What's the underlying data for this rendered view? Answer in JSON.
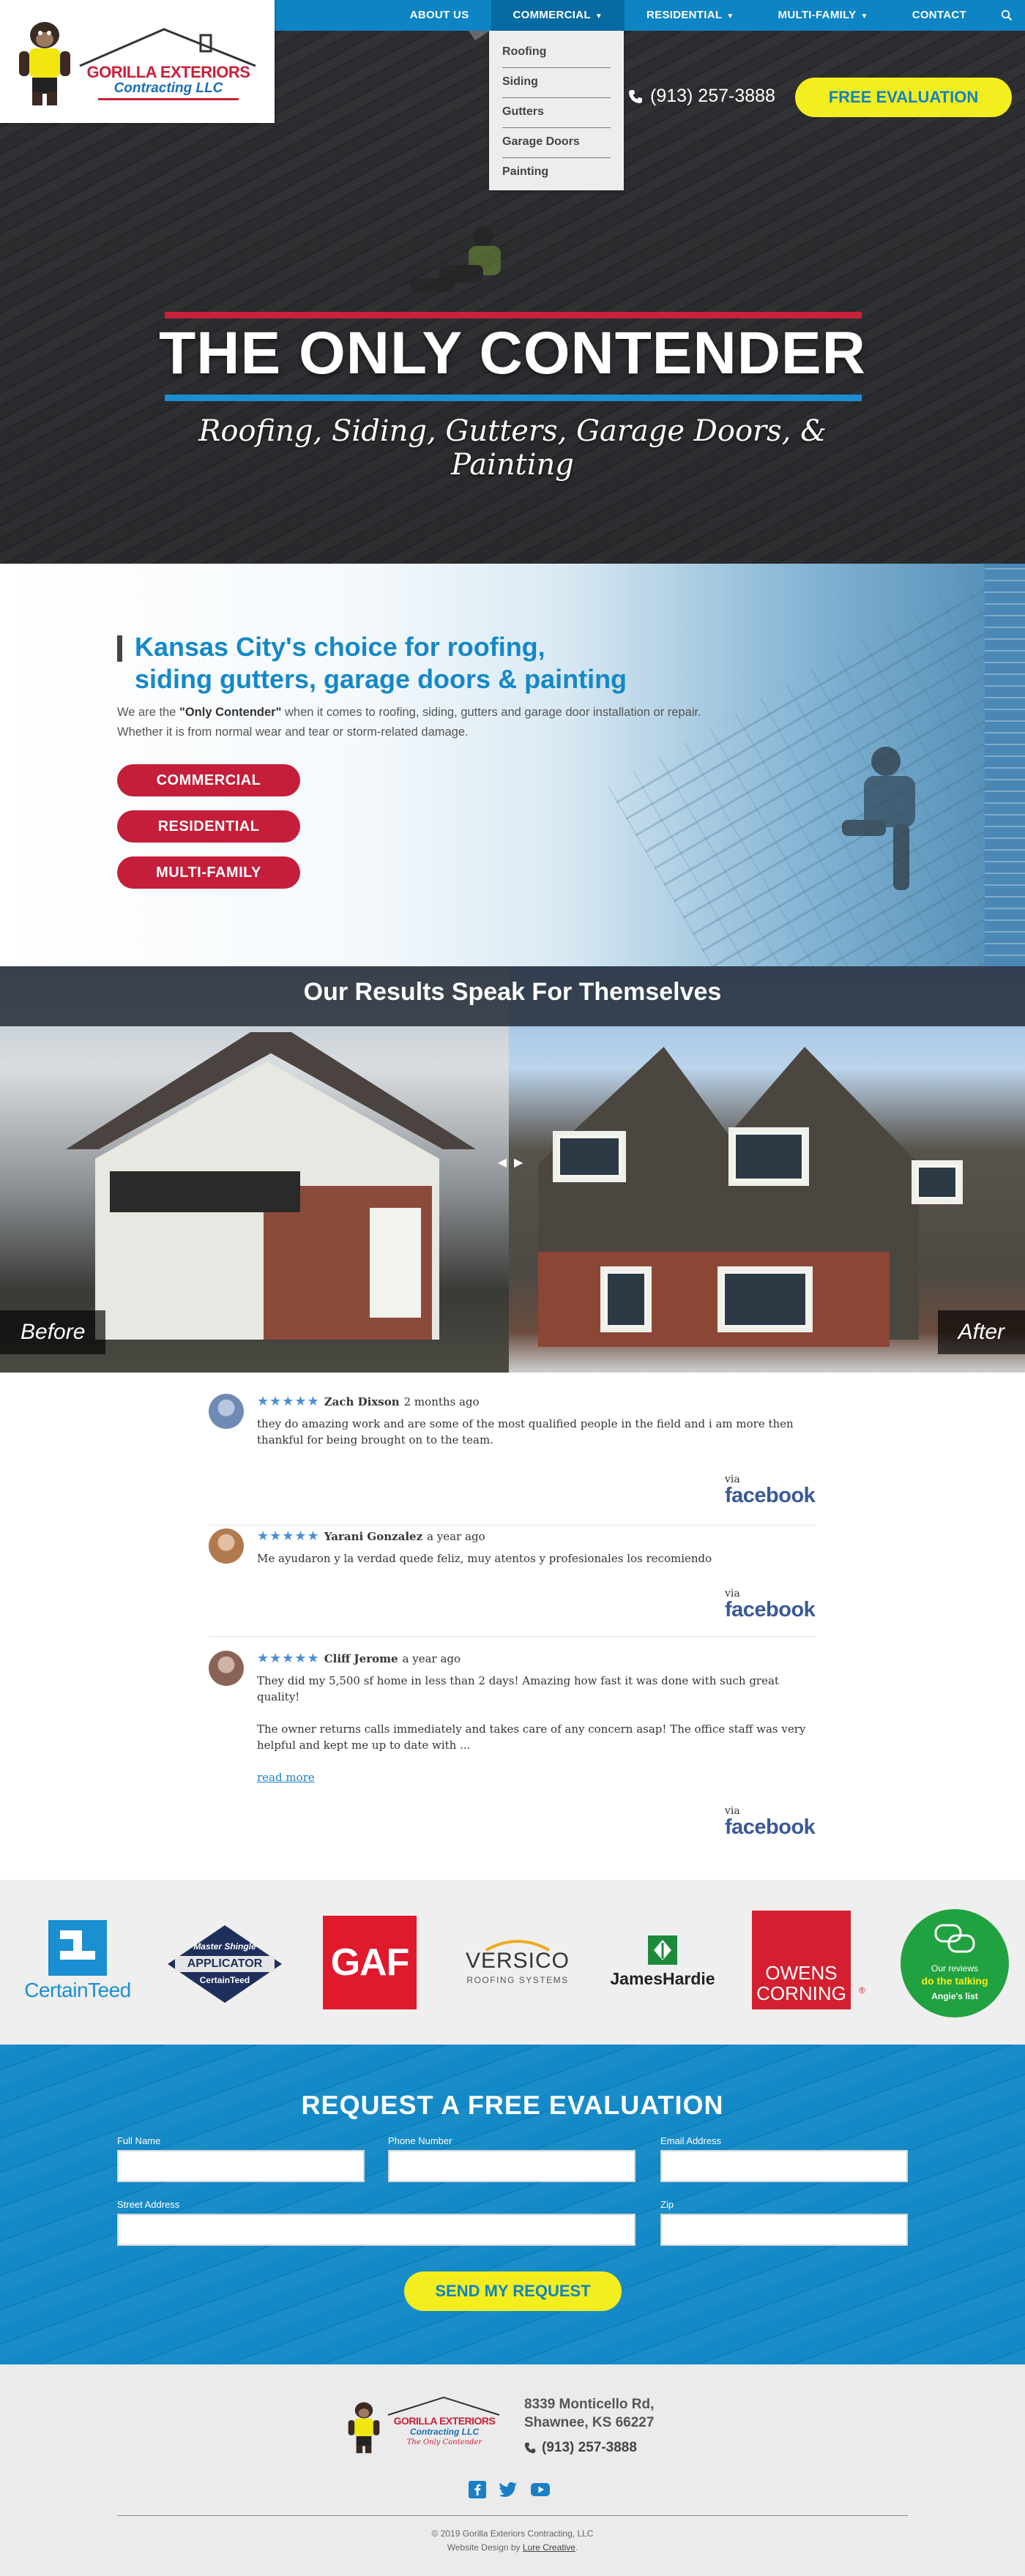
{
  "header": {
    "logo": {
      "line1": "GORILLA EXTERIORS",
      "line2": "Contracting LLC"
    },
    "nav": [
      {
        "label": "ABOUT US",
        "has_caret": false
      },
      {
        "label": "COMMERCIAL",
        "has_caret": true
      },
      {
        "label": "RESIDENTIAL",
        "has_caret": true
      },
      {
        "label": "MULTI-FAMILY",
        "has_caret": true
      },
      {
        "label": "CONTACT",
        "has_caret": false
      }
    ],
    "dropdown": [
      "Roofing",
      "Siding",
      "Gutters",
      "Garage Doors",
      "Painting"
    ],
    "phone": "(913) 257-3888",
    "cta": "FREE EVALUATION"
  },
  "hero": {
    "title": "THE ONLY CONTENDER",
    "subtitle": "Roofing, Siding, Gutters, Garage Doors, & Painting"
  },
  "intro": {
    "title_line1": "Kansas City's choice for roofing,",
    "title_line2": "siding gutters, garage doors & painting",
    "text_prefix": "We are the ",
    "text_bold": "\"Only Contender\"",
    "text_suffix": " when it comes to roofing, siding, gutters and garage door installation or repair. Whether it is from normal wear and tear or storm-related damage.",
    "buttons": [
      "COMMERCIAL",
      "RESIDENTIAL",
      "MULTI-FAMILY"
    ]
  },
  "results": {
    "title": "Our Results Speak For Themselves",
    "before_label": "Before",
    "after_label": "After"
  },
  "reviews": [
    {
      "stars": "★★★★★",
      "name": "Zach Dixson",
      "time": "2 months ago",
      "paragraphs": [
        "they do amazing work and are some of the most qualified people in the field and i am more then thankful for being brought on to the team."
      ],
      "read_more": "",
      "avatar_color": "#6f8bb5"
    },
    {
      "stars": "★★★★★",
      "name": "Yarani Gonzalez",
      "time": "a year ago",
      "paragraphs": [
        "Me ayudaron y la verdad quede feliz, muy atentos y profesionales los recomiendo"
      ],
      "read_more": "",
      "avatar_color": "#b07a4e"
    },
    {
      "stars": "★★★★★",
      "name": "Cliff Jerome",
      "time": "a year ago",
      "paragraphs": [
        "They did my 5,500 sf home in less than 2 days! Amazing how fast it was done with such great quality!",
        "The owner returns calls immediately and takes care of any concern asap! The office staff was very helpful and kept me up to date with ..."
      ],
      "read_more": "read more",
      "avatar_color": "#8a6357"
    }
  ],
  "review_source": {
    "via": "via",
    "name": "facebook"
  },
  "brands": {
    "certainteed": "CertainTeed",
    "master_shingle": {
      "line1": "Master Shingle",
      "line2": "APPLICATOR",
      "line3": "CertainTeed"
    },
    "gaf": "GAF",
    "versico": {
      "name": "VERSICO",
      "sub": "ROOFING SYSTEMS"
    },
    "jameshardie": "JamesHardie",
    "owens": {
      "line1": "OWENS",
      "line2": "CORNING"
    },
    "angies": {
      "line1": "Our reviews",
      "line2": "do the talking",
      "line3": "Angie's list"
    }
  },
  "form": {
    "title": "REQUEST A FREE EVALUATION",
    "fields": {
      "full_name": "Full Name",
      "phone": "Phone Number",
      "email": "Email Address",
      "street": "Street Address",
      "zip": "Zip"
    },
    "submit": "SEND MY REQUEST"
  },
  "footer": {
    "address_line1": "8339 Monticello Rd,",
    "address_line2": "Shawnee, KS 66227",
    "phone": "(913) 257-3888",
    "logo_tagline": "The Only Contender",
    "copyright": "© 2019 Gorilla Exteriors Contracting, LLC",
    "credit_prefix": "Website Design by ",
    "credit_link": "Lure Creative",
    "credit_suffix": "."
  },
  "colors": {
    "brand_blue": "#0d84c4",
    "nav_active": "#086aa3",
    "accent_yellow": "#f5ee1e",
    "accent_red": "#c41e3a",
    "facebook": "#3b5998"
  },
  "icons": [
    "search-icon",
    "phone-icon",
    "chevron-down-icon",
    "star-icon",
    "facebook-icon",
    "twitter-icon",
    "youtube-icon",
    "gorilla-mascot-icon"
  ]
}
